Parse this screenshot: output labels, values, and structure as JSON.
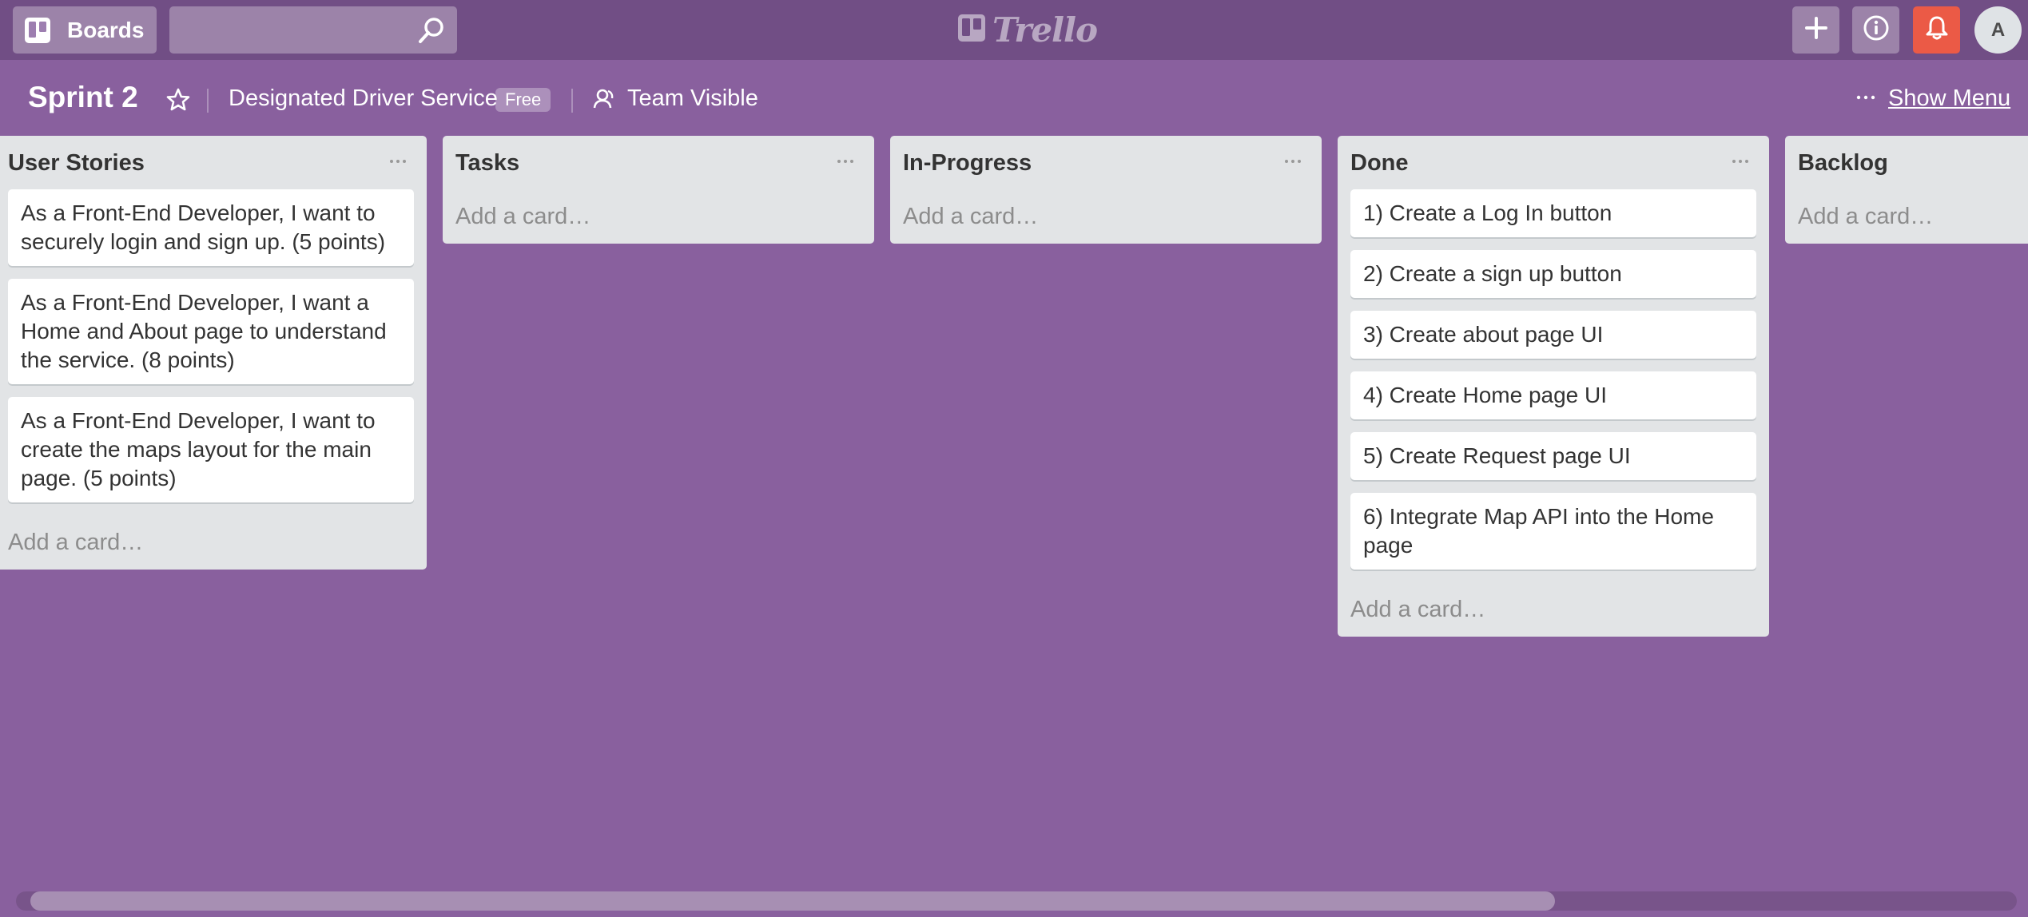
{
  "header": {
    "boards_label": "Boards",
    "search": {
      "value": "",
      "placeholder": ""
    },
    "logo_text": "Trello",
    "avatar_initial": "A",
    "icons": {
      "boards": "boards-icon",
      "search": "search-icon",
      "add": "plus-icon",
      "info": "info-icon",
      "notifications": "bell-icon"
    }
  },
  "board": {
    "title": "Sprint 2",
    "team": "Designated Driver Service",
    "plan_badge": "Free",
    "visibility": "Team Visible",
    "show_menu_label": "Show Menu"
  },
  "lists": [
    {
      "title": "User Stories",
      "cards": [
        "As a Front-End Developer, I want to securely login and sign up. (5 points)",
        "As a Front-End Developer, I want a Home and About page to understand the service. (8 points)",
        "As a Front-End Developer, I want to create the maps layout for the main page. (5 points)"
      ],
      "add_card_label": "Add a card…"
    },
    {
      "title": "Tasks",
      "cards": [],
      "add_card_label": "Add a card…"
    },
    {
      "title": "In-Progress",
      "cards": [],
      "add_card_label": "Add a card…"
    },
    {
      "title": "Done",
      "cards": [
        "1) Create a Log In button",
        "2) Create a sign up button",
        "3) Create about page UI",
        "4) Create Home page UI",
        "5) Create Request page UI",
        "6) Integrate Map API into the Home page"
      ],
      "add_card_label": "Add a card…"
    },
    {
      "title": "Backlog",
      "cards": [],
      "add_card_label": "Add a card…"
    }
  ],
  "colors": {
    "board_background": "#89609e",
    "header_background": "#714e85",
    "list_background": "#e2e4e6",
    "notification_red": "#eb5a46"
  }
}
